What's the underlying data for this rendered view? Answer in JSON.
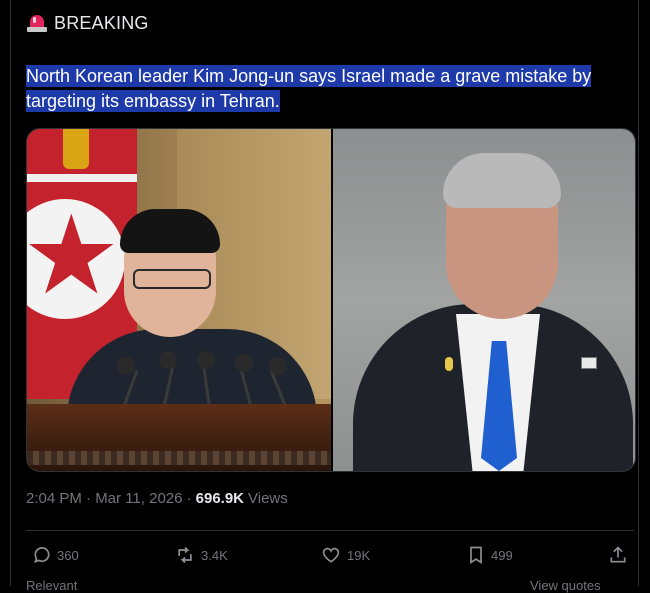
{
  "tweet": {
    "label": "BREAKING",
    "label_icon": "siren-icon",
    "headline": "North Korean leader Kim Jong-un says Israel made a grave mistake by targeting its embassy in Tehran.",
    "timestamp": "2:04 PM · Mar 11, 2026 ·",
    "views_count": "696.9K",
    "views_label": "Views",
    "highlight_color": "#1e3aa8"
  },
  "actions": {
    "reply_count": "360",
    "repost_count": "3.4K",
    "like_count": "19K",
    "bookmark_count": "499"
  },
  "footer": {
    "left_cut": "Relevant",
    "right_cut": "View quotes"
  }
}
